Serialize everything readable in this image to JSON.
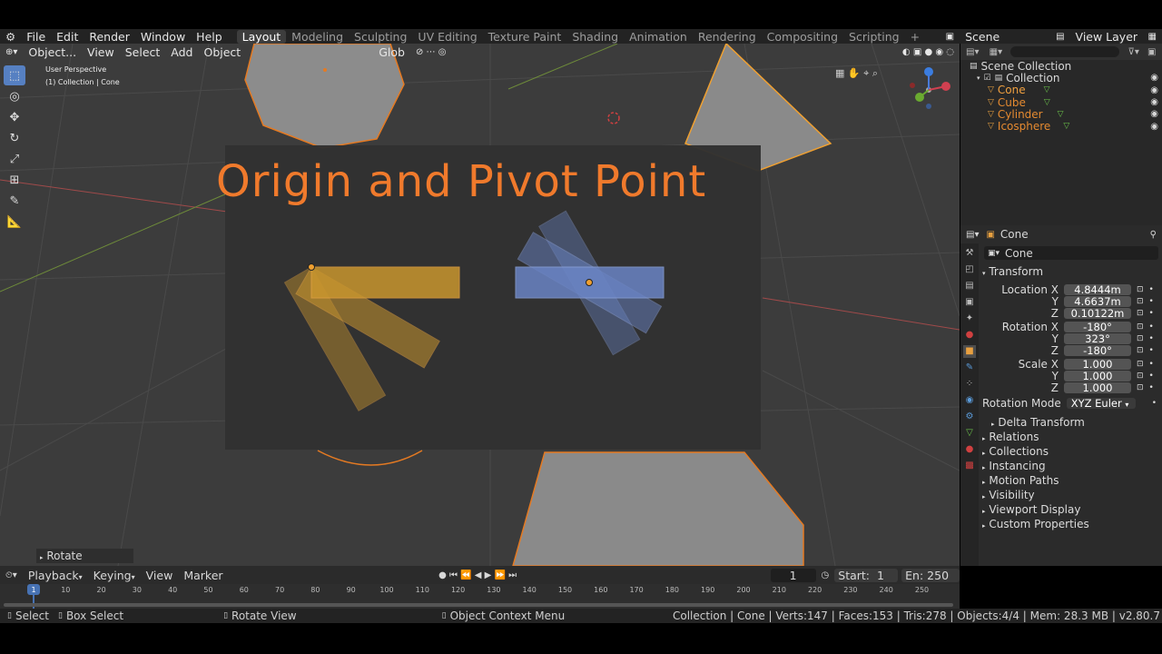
{
  "menubar": {
    "menus": [
      "File",
      "Edit",
      "Render",
      "Window",
      "Help"
    ],
    "workspaces": [
      "Layout",
      "Modeling",
      "Sculpting",
      "UV Editing",
      "Texture Paint",
      "Shading",
      "Animation",
      "Rendering",
      "Compositing",
      "Scripting"
    ],
    "active_workspace": "Layout",
    "scene": "Scene",
    "view_layer": "View Layer"
  },
  "viewport": {
    "mode": "Object...",
    "menus": [
      "View",
      "Select",
      "Add",
      "Object"
    ],
    "orientation": "Glob",
    "perspective": "User Perspective",
    "collection_info": "(1) Collection | Cone",
    "title": "Origin and Pivot Point",
    "last_operator": "Rotate"
  },
  "outliner": {
    "root": "Scene Collection",
    "collection": "Collection",
    "objects": [
      "Cone",
      "Cube",
      "Cylinder",
      "Icosphere"
    ]
  },
  "properties": {
    "object_name": "Cone",
    "data_name": "Cone",
    "transform_label": "Transform",
    "location_label": "Location",
    "rotation_label": "Rotation",
    "scale_label": "Scale",
    "location": {
      "x": "4.8444m",
      "y": "4.6637m",
      "z": "0.10122m"
    },
    "rotation": {
      "x": "-180°",
      "y": "323°",
      "z": "-180°"
    },
    "scale": {
      "x": "1.000",
      "y": "1.000",
      "z": "1.000"
    },
    "rotation_mode_label": "Rotation Mode",
    "rotation_mode": "XYZ Euler",
    "delta_transform": "Delta Transform",
    "panels": [
      "Relations",
      "Collections",
      "Instancing",
      "Motion Paths",
      "Visibility",
      "Viewport Display",
      "Custom Properties"
    ]
  },
  "timeline": {
    "menus": [
      "Playback",
      "Keying",
      "View",
      "Marker"
    ],
    "current_frame": "1",
    "start_label": "Start:",
    "start": "1",
    "end_label": "En:",
    "end": "250",
    "ticks": [
      "1",
      "10",
      "20",
      "30",
      "40",
      "50",
      "60",
      "70",
      "80",
      "90",
      "100",
      "110",
      "120",
      "130",
      "140",
      "150",
      "160",
      "170",
      "180",
      "190",
      "200",
      "210",
      "220",
      "230",
      "240",
      "250"
    ]
  },
  "status": {
    "select": "Select",
    "box_select": "Box Select",
    "rotate_view": "Rotate View",
    "context_menu": "Object Context Menu",
    "stats": "Collection | Cone | Verts:147 | Faces:153 | Tris:278 | Objects:4/4 | Mem: 28.3 MB | v2.80.7"
  },
  "colors": {
    "accent": "#f07a2c",
    "active_blue": "#5680c2",
    "orange_rect": "#c8952e",
    "blue_rect": "#6a84c4"
  }
}
